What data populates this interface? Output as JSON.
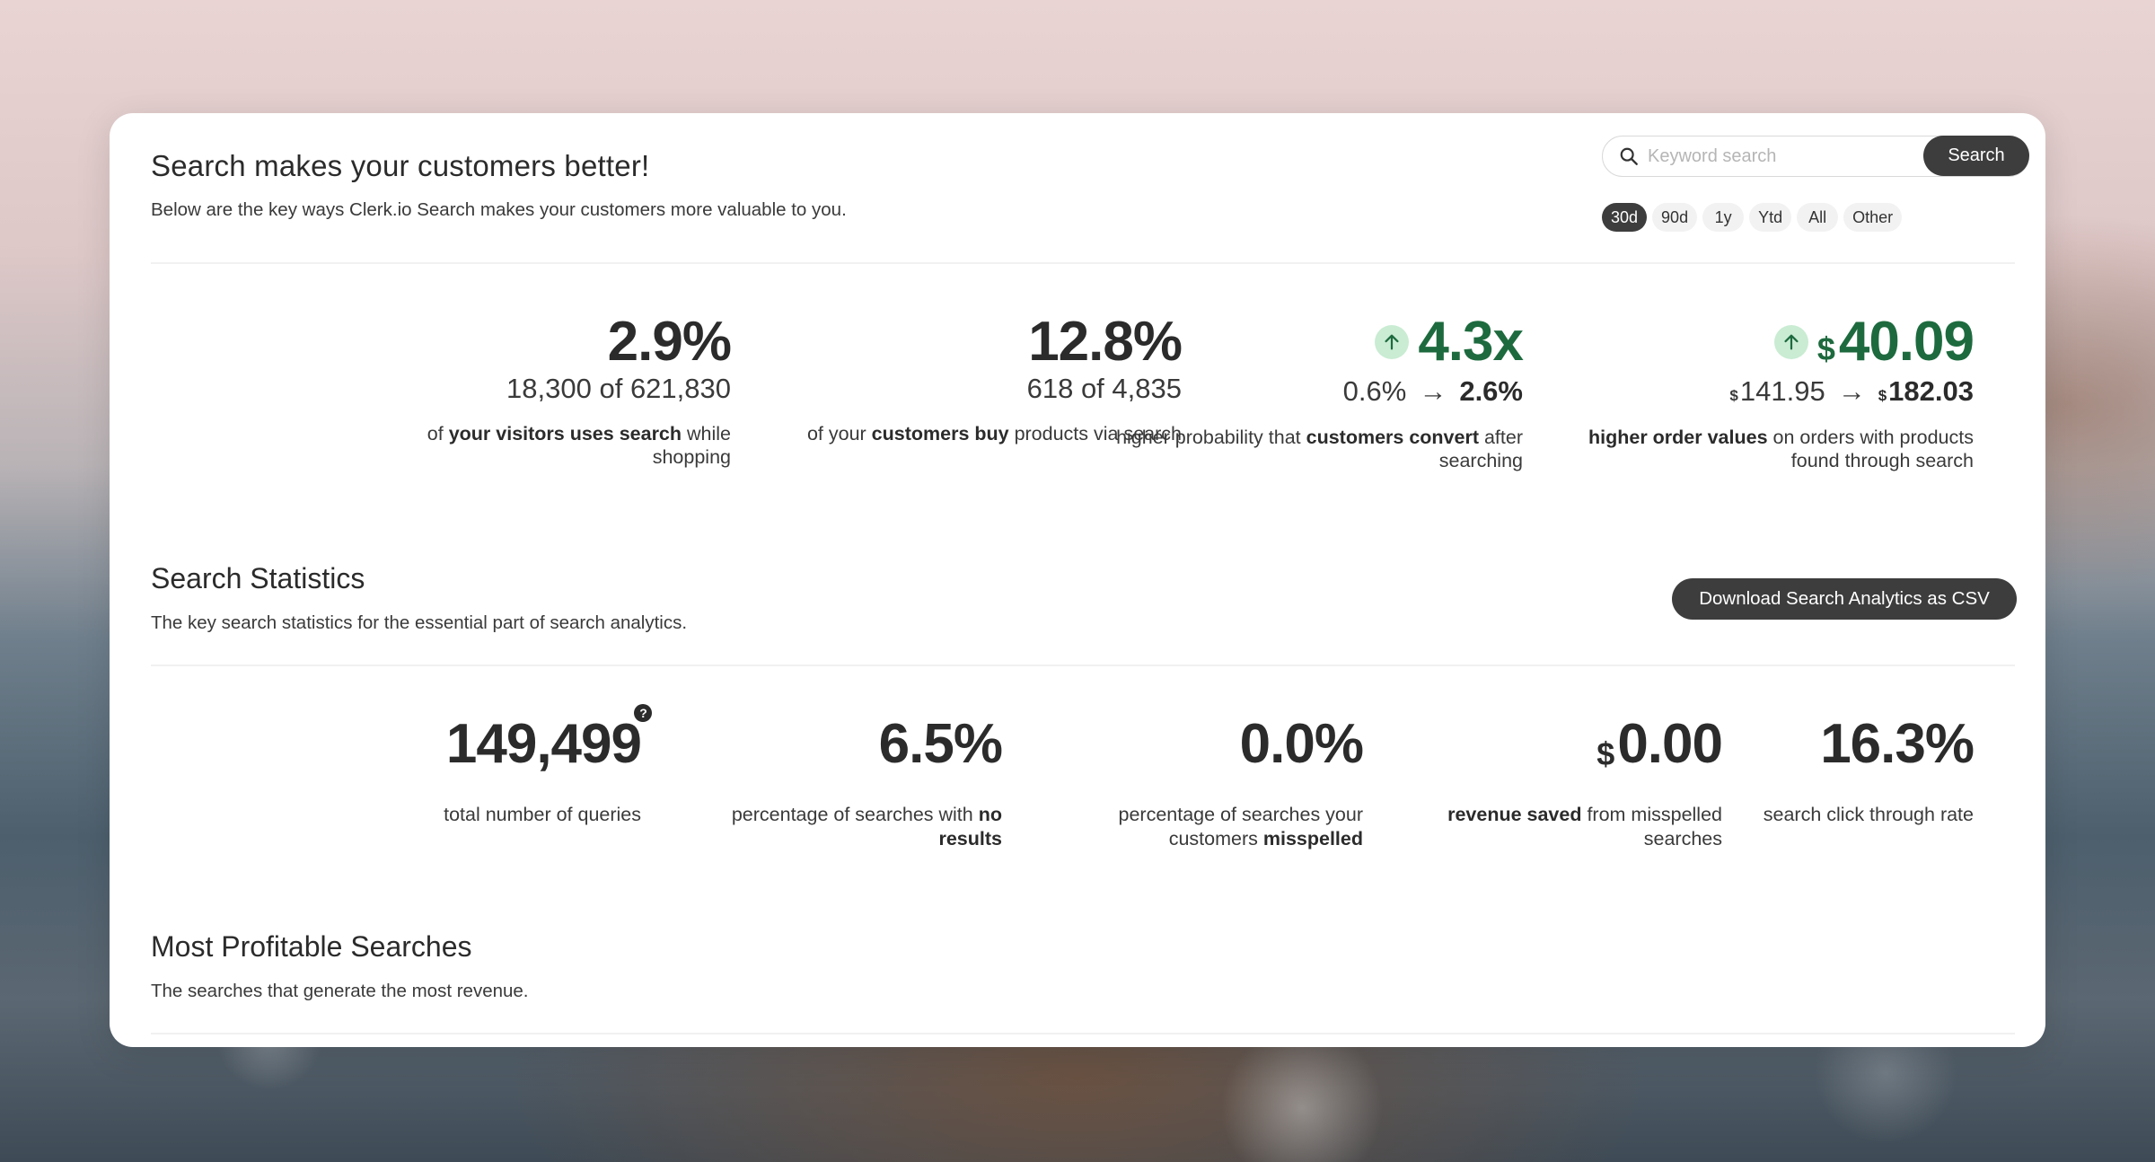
{
  "header": {
    "title": "Search makes your customers better!",
    "subtitle": "Below are the key ways Clerk.io Search makes your customers more valuable to you."
  },
  "search": {
    "placeholder": "Keyword search",
    "button_label": "Search"
  },
  "periods": [
    {
      "label": "30d",
      "active": true
    },
    {
      "label": "90d",
      "active": false
    },
    {
      "label": "1y",
      "active": false
    },
    {
      "label": "Ytd",
      "active": false
    },
    {
      "label": "All",
      "active": false
    },
    {
      "label": "Other",
      "active": false
    }
  ],
  "kpis": {
    "visitors": {
      "value": "2.9%",
      "detail": "18,300 of 621,830",
      "desc_pre": "of ",
      "desc_bold": "your visitors uses search",
      "desc_post": " while shopping"
    },
    "customers": {
      "value": "12.8%",
      "detail": "618 of 4,835",
      "desc_pre": "of your ",
      "desc_bold": "customers buy",
      "desc_post": " products via search"
    },
    "conversion": {
      "value": "4.3x",
      "from": "0.6%",
      "arrow": "→",
      "to": "2.6%",
      "desc_pre": "higher probability that ",
      "desc_bold": "customers convert",
      "desc_post": " after searching"
    },
    "order_value": {
      "currency": "$",
      "value": "40.09",
      "from": "141.95",
      "arrow": "→",
      "to": "182.03",
      "desc_bold": "higher order values",
      "desc_post": " on orders with products found through search"
    }
  },
  "stats_section": {
    "title": "Search Statistics",
    "subtitle": "The key search statistics for the essential part of search analytics.",
    "csv_button": "Download Search Analytics as CSV",
    "help_glyph": "?",
    "items": {
      "queries": {
        "value": "149,499",
        "desc": "total number of queries"
      },
      "no_results": {
        "value": "6.5%",
        "desc_pre": "percentage of searches with ",
        "desc_bold": "no results"
      },
      "misspelled": {
        "value": "0.0%",
        "desc_pre": "percentage of searches your customers ",
        "desc_bold": "misspelled"
      },
      "revenue_saved": {
        "currency": "$",
        "value": "0.00",
        "desc_bold": "revenue saved",
        "desc_post": " from misspelled searches"
      },
      "ctr": {
        "value": "16.3%",
        "desc": "search click through rate"
      }
    }
  },
  "profitable_section": {
    "title": "Most Profitable Searches",
    "subtitle": "The searches that generate the most revenue."
  },
  "colors": {
    "accent_green": "#1d6a3e",
    "green_badge_bg": "#c9ecd3",
    "dark_button": "#3d3d3d"
  },
  "icons": [
    "search-icon",
    "arrow-up-icon",
    "help-icon",
    "right-arrow-icon"
  ]
}
